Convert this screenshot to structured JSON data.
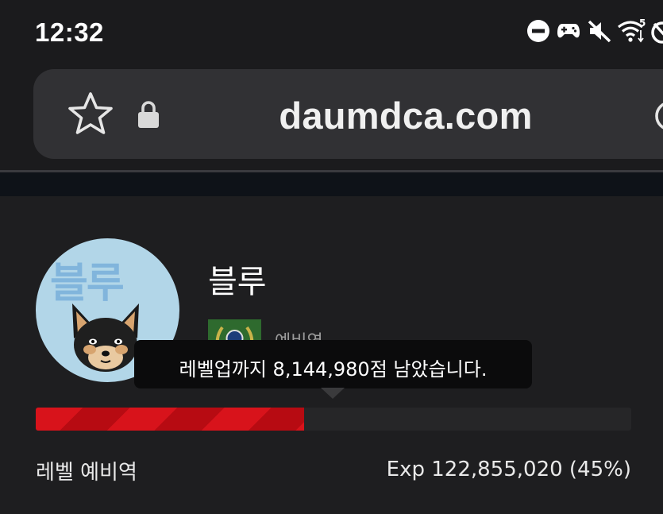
{
  "status_bar": {
    "time": "12:32",
    "icons": [
      "do-not-disturb-icon",
      "gamepad-icon",
      "mute-icon",
      "wifi-icon",
      "alarm-off-icon"
    ],
    "wifi_badge": "5"
  },
  "browser": {
    "url": "daumdca.com",
    "icons": [
      "star-icon",
      "lock-icon",
      "reload-icon"
    ]
  },
  "profile": {
    "avatar_text": "블루",
    "name": "블루",
    "level_name": "예비역"
  },
  "tooltip": {
    "text": "레벨업까지 8,144,980점 남았습니다."
  },
  "progress": {
    "percent": 45,
    "level_label": "레벨 예비역",
    "exp_label": "Exp 122,855,020 (45%)"
  },
  "colors": {
    "background": "#1e1e20",
    "progress_fill": "#d8131b",
    "tooltip_bg": "#0b0b0c",
    "avatar_bg": "#b2d6e8"
  }
}
